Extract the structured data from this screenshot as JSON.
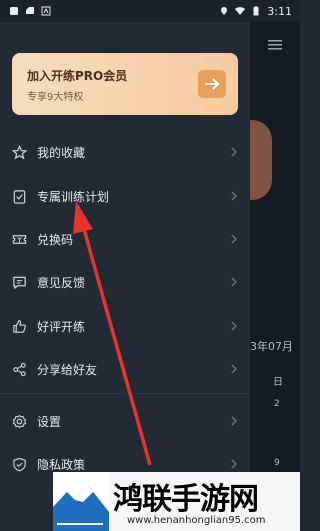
{
  "status": {
    "time": "3:11"
  },
  "pro_card": {
    "title": "加入开练PRO会员",
    "subtitle": "专享9大特权"
  },
  "menu": [
    {
      "label": "我的收藏",
      "icon": "star-icon"
    },
    {
      "label": "专属训练计划",
      "icon": "clipboard-check-icon"
    },
    {
      "label": "兑换码",
      "icon": "ticket-icon"
    },
    {
      "label": "意见反馈",
      "icon": "chat-icon"
    },
    {
      "label": "好评开练",
      "icon": "thumbs-up-icon"
    },
    {
      "label": "分享给好友",
      "icon": "share-icon"
    },
    {
      "label": "设置",
      "icon": "gear-icon"
    },
    {
      "label": "隐私政策",
      "icon": "shield-check-icon"
    }
  ],
  "background": {
    "month": "3年07月",
    "day_header": "日",
    "num1": "2",
    "num2": "9"
  },
  "watermark": {
    "title": "鸿联手游网",
    "url": "www.henanhonglian95.com"
  },
  "colors": {
    "accent": "#e7a15c",
    "arrow": "#e8342c"
  }
}
